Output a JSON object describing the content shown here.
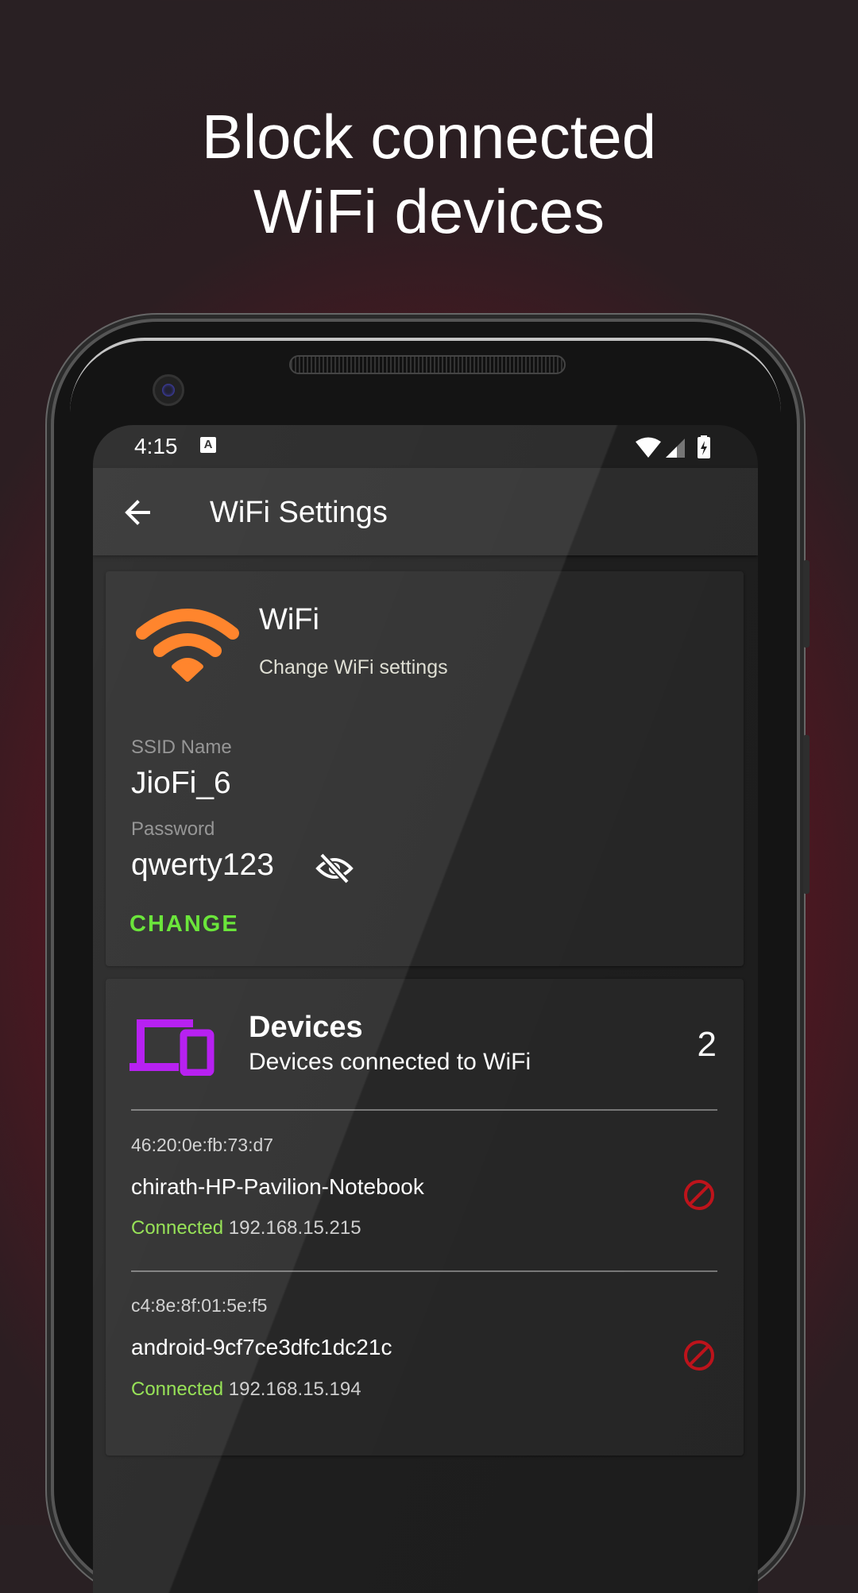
{
  "headline": {
    "line1": "Block connected",
    "line2": "WiFi devices"
  },
  "status_bar": {
    "time": "4:15",
    "notification_glyph": "A",
    "icons": [
      "wifi-icon",
      "cell-signal-icon",
      "battery-charging-icon"
    ]
  },
  "app_bar": {
    "title": "WiFi Settings",
    "back_icon": "arrow-left-icon"
  },
  "wifi_card": {
    "icon": "wifi-icon",
    "title": "WiFi",
    "subtitle": "Change WiFi settings",
    "ssid_label": "SSID Name",
    "ssid_value": "JioFi_6",
    "password_label": "Password",
    "password_value": "qwerty123",
    "password_toggle_icon": "eye-off-icon",
    "change_label": "CHANGE"
  },
  "devices_card": {
    "icon": "devices-icon",
    "title": "Devices",
    "subtitle": "Devices connected to WiFi",
    "count": "2",
    "devices": [
      {
        "mac": "46:20:0e:fb:73:d7",
        "name": "chirath-HP-Pavilion-Notebook",
        "status": "Connected",
        "ip": "192.168.15.215",
        "block_icon": "block-icon"
      },
      {
        "mac": "c4:8e:8f:01:5e:f5",
        "name": "android-9cf7ce3dfc1dc21c",
        "status": "Connected",
        "ip": "192.168.15.194",
        "block_icon": "block-icon"
      }
    ]
  },
  "colors": {
    "wifi_orange": "#ff7a1a",
    "devices_purple": "#b10ef0",
    "accent_green": "#5ee32a",
    "connected_green": "#8fe04a",
    "block_red": "#c4141c"
  }
}
